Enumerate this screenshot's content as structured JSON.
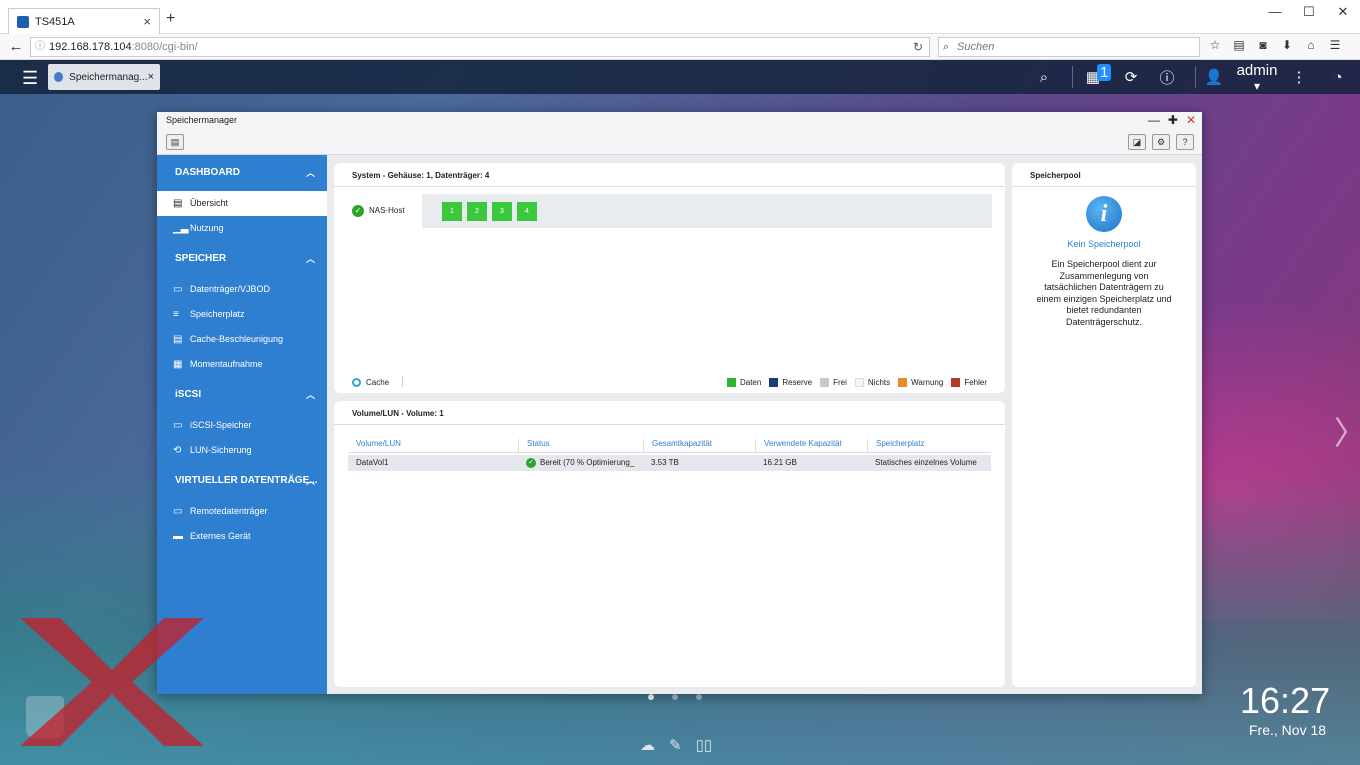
{
  "browser": {
    "tab_title": "TS451A",
    "tab_close": "×",
    "new_tab": "+",
    "url_main": "192.168.178.104",
    "url_rest": ":8080/cgi-bin/",
    "search_placeholder": "Suchen"
  },
  "qts": {
    "app_tab_label": "Speichermanag...",
    "app_tab_close": "×",
    "notification_count": "1",
    "user_label": "admin"
  },
  "window": {
    "title": "Speichermanager"
  },
  "sidebar": {
    "sections": [
      {
        "label": "DASHBOARD",
        "items": [
          "Übersicht",
          "Nutzung"
        ]
      },
      {
        "label": "SPEICHER",
        "items": [
          "Datenträger/VJBOD",
          "Speicherplatz",
          "Cache-Beschleunigung",
          "Momentaufnahme"
        ]
      },
      {
        "label": "iSCSI",
        "items": [
          "iSCSI-Speicher",
          "LUN-Sicherung"
        ]
      },
      {
        "label": "VIRTUELLER DATENTRÄGE...",
        "items": [
          "Remotedatenträger",
          "Externes Gerät"
        ]
      }
    ]
  },
  "system_panel": {
    "title": "System - Gehäuse: 1, Datenträger: 4",
    "host_label": "NAS-Host",
    "disks": [
      "1",
      "2",
      "3",
      "4"
    ],
    "cache_label": "Cache",
    "legend": [
      {
        "label": "Daten",
        "color": "#2fb52f"
      },
      {
        "label": "Reserve",
        "color": "#1d3b7a"
      },
      {
        "label": "Frei",
        "color": "#c8c8c8"
      },
      {
        "label": "Nichts",
        "color": "#f4f4f4"
      },
      {
        "label": "Warnung",
        "color": "#e8892a"
      },
      {
        "label": "Fehler",
        "color": "#b23a2a"
      }
    ]
  },
  "volume_panel": {
    "title": "Volume/LUN - Volume: 1",
    "columns": [
      "Volume/LUN",
      "Status",
      "Gesamtkapazität",
      "Verwendete Kapazität",
      "Speicherplatz"
    ],
    "rows": [
      {
        "name": "DataVol1",
        "status": "Bereit (70 % Optimierung_",
        "total": "3.53 TB",
        "used": "16.21 GB",
        "space": "Statisches einzelnes Volume"
      }
    ]
  },
  "pool_panel": {
    "title": "Speicherpool",
    "empty_title": "Kein Speicherpool",
    "description": "Ein Speicherpool dient zur Zusammenlegung von tatsächlichen Datenträgern zu einem einzigen Speicherplatz und bietet redundanten Datenträgerschutz."
  },
  "desktop": {
    "time": "16:27",
    "date": "Fre., Nov 18",
    "page_dots": 3,
    "active_dot": 0
  }
}
